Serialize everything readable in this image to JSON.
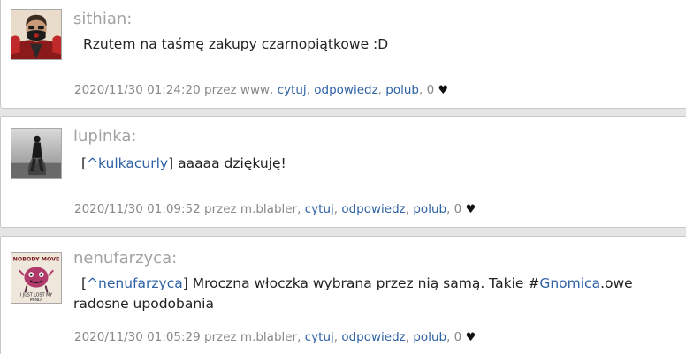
{
  "posts": [
    {
      "username": "sithian:",
      "avatar_icon": "masked-man-avatar-icon",
      "text": "Rzutem na taśmę zakupy czarnopiątkowe :D",
      "timestamp": "2020/11/30 01:24:20",
      "via": "przez www,",
      "actions": {
        "quote": "cytuj",
        "reply": "odpowiedz",
        "like": "polub"
      },
      "likes": "0",
      "heart_icon": "heart-icon"
    },
    {
      "username": "lupinka:",
      "avatar_icon": "walking-figure-avatar-icon",
      "mention": "^kulkacurly",
      "text": "aaaaa dziękuję!",
      "timestamp": "2020/11/30 01:09:52",
      "via": "przez m.blabler,",
      "actions": {
        "quote": "cytuj",
        "reply": "odpowiedz",
        "like": "polub"
      },
      "likes": "0",
      "heart_icon": "heart-icon"
    },
    {
      "username": "nenufarzyca:",
      "avatar_icon": "nobody-move-creature-avatar-icon",
      "avatar_text": "NOBODY MOVE · I JUST LOST MY MIND",
      "mention": "^nenufarzyca",
      "text_before_tag": "Mroczna włoczka wybrana przez nią samą. Takie #",
      "tag": "Gnomica",
      "text_after_tag": ".owe radosne upodobania",
      "timestamp": "2020/11/30 01:05:29",
      "via": "przez m.blabler,",
      "actions": {
        "quote": "cytuj",
        "reply": "odpowiedz",
        "like": "polub"
      },
      "likes": "0",
      "heart_icon": "heart-icon"
    }
  ],
  "colors": {
    "link": "#2f62a4",
    "username": "#a2a2a2",
    "meta": "#888888",
    "background": "#e5e5e5",
    "card": "#ffffff"
  }
}
